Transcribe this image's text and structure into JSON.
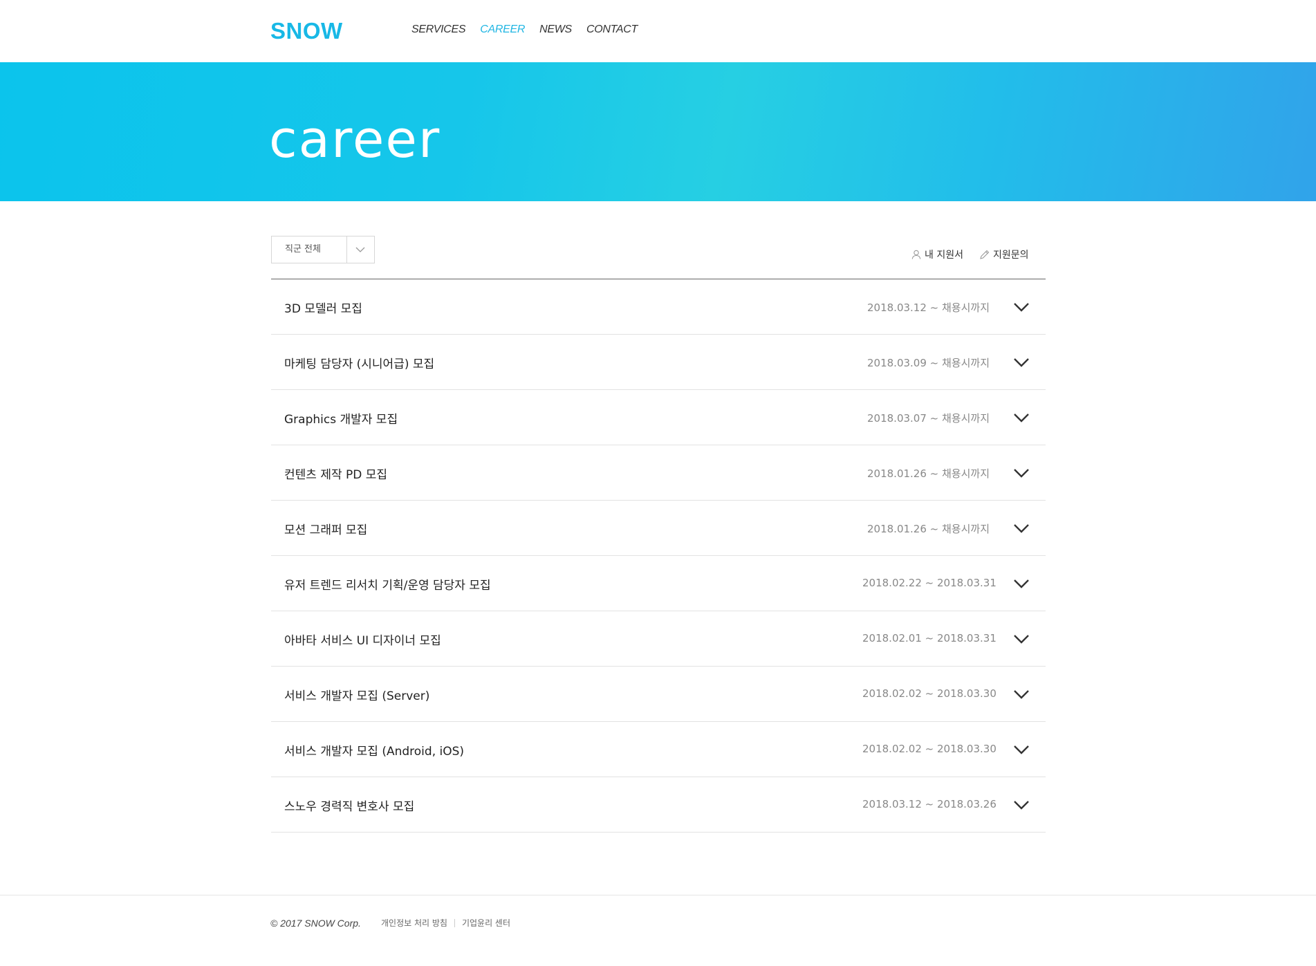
{
  "header": {
    "logo": "SNOW",
    "nav": [
      {
        "label": "SERVICES",
        "active": false
      },
      {
        "label": "CAREER",
        "active": true
      },
      {
        "label": "NEWS",
        "active": false
      },
      {
        "label": "CONTACT",
        "active": false
      }
    ]
  },
  "hero": {
    "title": "career"
  },
  "filter": {
    "selected": "직군 전체"
  },
  "utility": {
    "my_application": "내 지원서",
    "inquiry": "지원문의"
  },
  "jobs": [
    {
      "title": "3D 모델러 모집",
      "period": "2018.03.12 ~ 채용시까지"
    },
    {
      "title": "마케팅 담당자 (시니어급) 모집",
      "period": "2018.03.09 ~ 채용시까지"
    },
    {
      "title": "Graphics 개발자 모집",
      "period": "2018.03.07 ~ 채용시까지"
    },
    {
      "title": "컨텐츠 제작 PD 모집",
      "period": "2018.01.26 ~ 채용시까지"
    },
    {
      "title": "모션 그래퍼 모집",
      "period": "2018.01.26 ~ 채용시까지"
    },
    {
      "title": "유저 트렌드 리서치 기획/운영 담당자 모집",
      "period": "2018.02.22 ~ 2018.03.31"
    },
    {
      "title": "아바타 서비스 UI 디자이너 모집",
      "period": "2018.02.01 ~ 2018.03.31"
    },
    {
      "title": "서비스 개발자 모집 (Server)",
      "period": "2018.02.02 ~ 2018.03.30"
    },
    {
      "title": "서비스 개발자 모집 (Android, iOS)",
      "period": "2018.02.02 ~ 2018.03.30"
    },
    {
      "title": "스노우 경력직 변호사 모집",
      "period": "2018.03.12 ~ 2018.03.26"
    }
  ],
  "footer": {
    "copyright": "© 2017 SNOW Corp.",
    "links": [
      "개인정보 처리 방침",
      "기업윤리 센터"
    ]
  },
  "colors": {
    "brand": "#18b8e6",
    "nav_active": "#21b6e3"
  }
}
